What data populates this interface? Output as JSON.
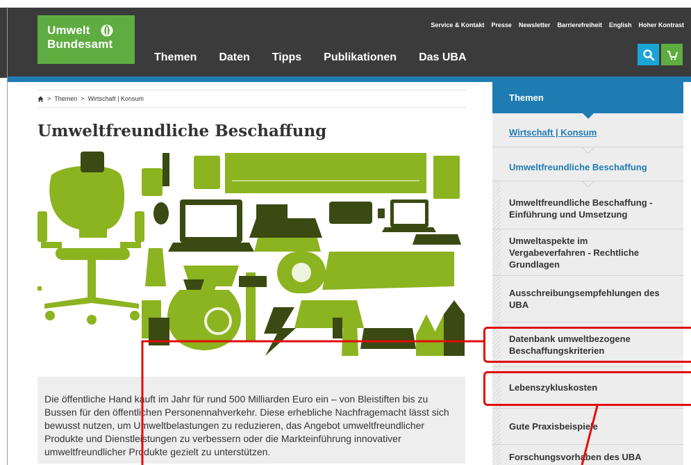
{
  "header": {
    "logo_line1": "Umwelt",
    "logo_line2": "Bundesamt",
    "top_links": [
      "Service & Kontakt",
      "Presse",
      "Newsletter",
      "Barrierefreiheit",
      "English",
      "Hoher Kontrast"
    ],
    "main_nav": [
      "Themen",
      "Daten",
      "Tipps",
      "Publikationen",
      "Das UBA"
    ],
    "search_icon": "search-icon",
    "cart_icon": "cart-icon"
  },
  "breadcrumb": {
    "home_icon": "home-icon",
    "items": [
      "Themen",
      "Wirtschaft | Konsum"
    ],
    "separator": ">"
  },
  "main": {
    "title": "Umweltfreundliche Beschaffung",
    "intro": "Die öffentliche Hand kauft im Jahr für rund 500 Milliarden Euro ein – von Bleistiften bis zu Bussen für den öffentlichen Personennahverkehr. Diese erhebliche Nachfragemacht lässt sich bewusst nutzen, um Umweltbelastungen zu reduzieren, das Angebot umweltfreundlicher Produkte und Dienstleistungen zu verbessern oder die Markteinführung innovativer umweltfreundlicher Produkte gezielt zu unterstützen."
  },
  "sidebar": {
    "heading": "Themen",
    "items": [
      {
        "label": "Wirtschaft | Konsum"
      },
      {
        "label": "Umweltfreundliche Beschaffung"
      },
      {
        "label": "Umweltfreundliche Beschaffung - Einführung und Umsetzung"
      },
      {
        "label": "Umweltaspekte im Vergabeverfahren - Rechtliche Grundlagen"
      },
      {
        "label": "Ausschreibungsempfehlungen des UBA"
      },
      {
        "label": "Datenbank umweltbezogene Beschaffungskriterien"
      },
      {
        "label": "Lebenszykluskosten"
      },
      {
        "label": "Gute Praxisbeispiele"
      },
      {
        "label": "Forschungsvorhaben des UBA"
      }
    ]
  },
  "colors": {
    "brand_green": "#5fad41",
    "brand_blue": "#1f7cb3",
    "search_blue": "#1aa5d6",
    "annotation_red": "#e10b0b",
    "illustration_green": "#8cb320",
    "illustration_dark": "#3a4a12"
  }
}
